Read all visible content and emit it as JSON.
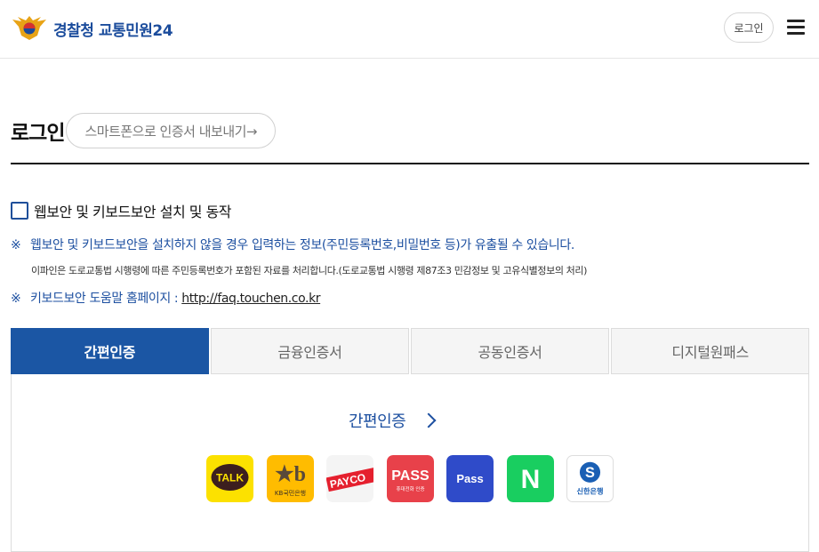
{
  "header": {
    "brand": "경찰청 교통민원24",
    "login_label": "로그인"
  },
  "page": {
    "title": "로그인",
    "export_button": "스마트폰으로 인증서 내보내기→"
  },
  "security": {
    "checkbox_label": "웹보안 및 키보드보안 설치 및 동작",
    "checked": false
  },
  "notices": {
    "mark": "※",
    "warning": "웹보안 및 키보드보안을 설치하지 않을 경우 입력하는 정보(주민등록번호,비밀번호 등)가 유출될 수 있습니다.",
    "privacy": "이파인은 도로교통법 시행령에 따른 주민등록번호가 포함된 자료를 처리합니다.(도로교통법 시행령 제87조3 민감정보 및 고유식별정보의 처리)",
    "help_label": "키보드보안 도움말 홈페이지 :",
    "help_url": "http://faq.touchen.co.kr"
  },
  "tabs": [
    {
      "label": "간편인증",
      "active": true
    },
    {
      "label": "금융인증서",
      "active": false
    },
    {
      "label": "공동인증서",
      "active": false
    },
    {
      "label": "디지털원패스",
      "active": false
    }
  ],
  "easy_auth": {
    "title": "간편인증",
    "providers": [
      {
        "name": "kakao",
        "text": "TALK",
        "color": "#FCE100"
      },
      {
        "name": "kb",
        "text": "KB국민은행",
        "color": "#FFBC00"
      },
      {
        "name": "payco",
        "text": "PAYCO",
        "color": "#F4F4F4"
      },
      {
        "name": "pass",
        "text": "PASS",
        "subtext": "휴대전화 인증",
        "color": "#E8414A"
      },
      {
        "name": "samsung-pass",
        "text": "Pass",
        "color": "#2F4BC9"
      },
      {
        "name": "naver",
        "text": "N",
        "color": "#19CE60"
      },
      {
        "name": "shinhan",
        "text": "신한은행",
        "color": "#FFFFFF"
      }
    ]
  }
}
